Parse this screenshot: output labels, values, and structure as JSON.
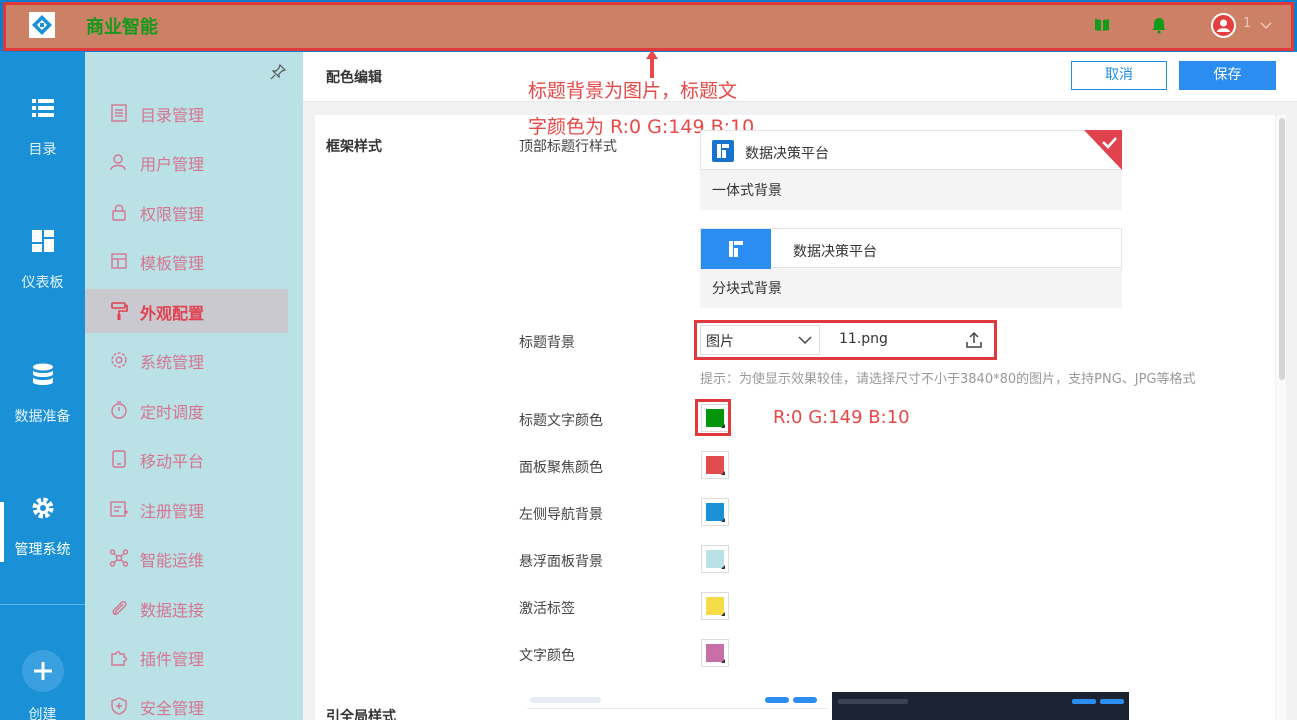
{
  "header": {
    "app_title": "商业智能",
    "user_name": "1"
  },
  "annotations": {
    "line1": "标题背景为图片，标题文",
    "line2": "字颜色为 R:0 G:149 B:10",
    "color_note": "R:0 G:149 B:10"
  },
  "rail": {
    "items": [
      {
        "label": "目录",
        "icon": "list-icon"
      },
      {
        "label": "仪表板",
        "icon": "dashboard-icon"
      },
      {
        "label": "数据准备",
        "icon": "database-icon"
      },
      {
        "label": "管理系统",
        "icon": "gear-icon"
      },
      {
        "label": "创建",
        "icon": "plus-icon"
      }
    ],
    "active": "管理系统"
  },
  "submenu": {
    "items": [
      {
        "label": "目录管理",
        "icon": "list-doc-icon"
      },
      {
        "label": "用户管理",
        "icon": "user-icon"
      },
      {
        "label": "权限管理",
        "icon": "lock-icon"
      },
      {
        "label": "模板管理",
        "icon": "template-icon"
      },
      {
        "label": "外观配置",
        "icon": "paint-roller-icon"
      },
      {
        "label": "系统管理",
        "icon": "settings-icon"
      },
      {
        "label": "定时调度",
        "icon": "timer-icon"
      },
      {
        "label": "移动平台",
        "icon": "tablet-icon"
      },
      {
        "label": "注册管理",
        "icon": "register-icon"
      },
      {
        "label": "智能运维",
        "icon": "network-icon"
      },
      {
        "label": "数据连接",
        "icon": "paperclip-icon"
      },
      {
        "label": "插件管理",
        "icon": "puzzle-icon"
      },
      {
        "label": "安全管理",
        "icon": "shield-icon"
      }
    ],
    "active": "外观配置"
  },
  "main": {
    "title": "配色编辑",
    "cancel_label": "取消",
    "save_label": "保存",
    "section_frame": "框架样式",
    "section_bottom": "引全局样式",
    "top_title_style_label": "顶部标题行样式",
    "style_options": [
      {
        "title": "数据决策平台",
        "caption": "一体式背景",
        "selected": true
      },
      {
        "title": "数据决策平台",
        "caption": "分块式背景",
        "selected": false
      }
    ],
    "title_bg_label": "标题背景",
    "title_bg_type": "图片",
    "title_bg_file": "11.png",
    "hint": "提示：为使显示效果较佳，请选择尺寸不小于3840*80的图片，支持PNG、JPG等格式",
    "color_fields": [
      {
        "label": "标题文字颜色",
        "color": "#00950a"
      },
      {
        "label": "面板聚焦颜色",
        "color": "#e04b4b"
      },
      {
        "label": "左侧导航背景",
        "color": "#1a90d6"
      },
      {
        "label": "悬浮面板背景",
        "color": "#b9e1e6"
      },
      {
        "label": "激活标签",
        "color": "#f7dc4a"
      },
      {
        "label": "文字颜色",
        "color": "#c96fa8"
      }
    ]
  }
}
